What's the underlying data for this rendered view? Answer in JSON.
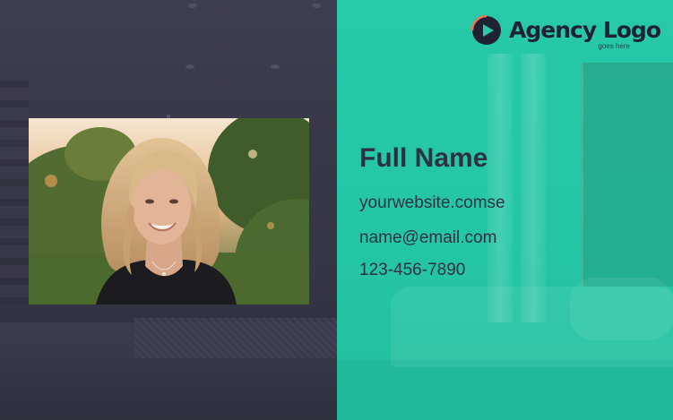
{
  "logo": {
    "title": "Agency Logo",
    "tagline": "goes here",
    "icon": "play-icon"
  },
  "contact": {
    "full_name": "Full Name",
    "website": "yourwebsite.comse",
    "email": "name@email.com",
    "phone": "123-456-7890"
  },
  "colors": {
    "left_panel": "#363747",
    "right_panel": "#26c8a7",
    "text": "#2e3140",
    "logo_dark": "#1f2233",
    "logo_ring": "#f0735a"
  }
}
